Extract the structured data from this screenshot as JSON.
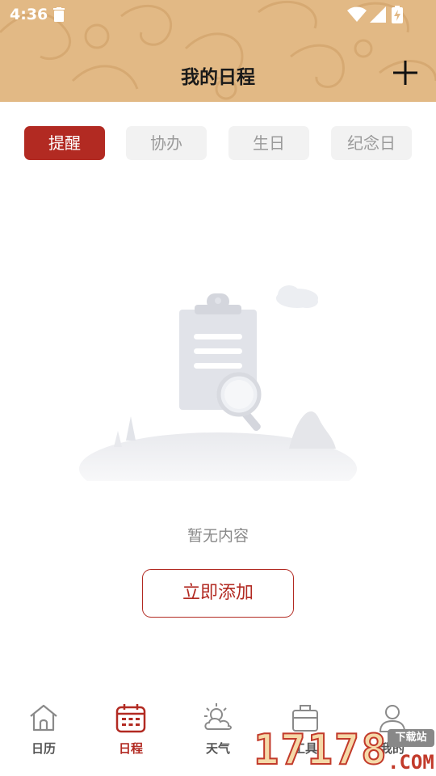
{
  "status_bar": {
    "time": "4:36"
  },
  "header": {
    "title": "我的日程",
    "add_icon": "plus-icon",
    "background_color": "#e2b985"
  },
  "tabs": [
    {
      "label": "提醒",
      "active": true
    },
    {
      "label": "协办",
      "active": false
    },
    {
      "label": "生日",
      "active": false
    },
    {
      "label": "纪念日",
      "active": false
    }
  ],
  "empty_state": {
    "illustration": "clipboard-magnifier-illustration",
    "message": "暂无内容",
    "button_label": "立即添加"
  },
  "bottom_nav": [
    {
      "label": "日历",
      "icon": "home-icon",
      "active": false
    },
    {
      "label": "日程",
      "icon": "calendar-icon",
      "active": true
    },
    {
      "label": "天气",
      "icon": "weather-icon",
      "active": false
    },
    {
      "label": "工具",
      "icon": "toolbox-icon",
      "active": false
    },
    {
      "label": "我的",
      "icon": "user-icon",
      "active": false
    }
  ],
  "watermark": {
    "digits": "17178",
    "tag": "下载站",
    "domain": ".COM"
  },
  "colors": {
    "accent": "#b22a22",
    "inactive_tab_bg": "#f2f2f2",
    "inactive_tab_text": "#9a9a9a"
  }
}
